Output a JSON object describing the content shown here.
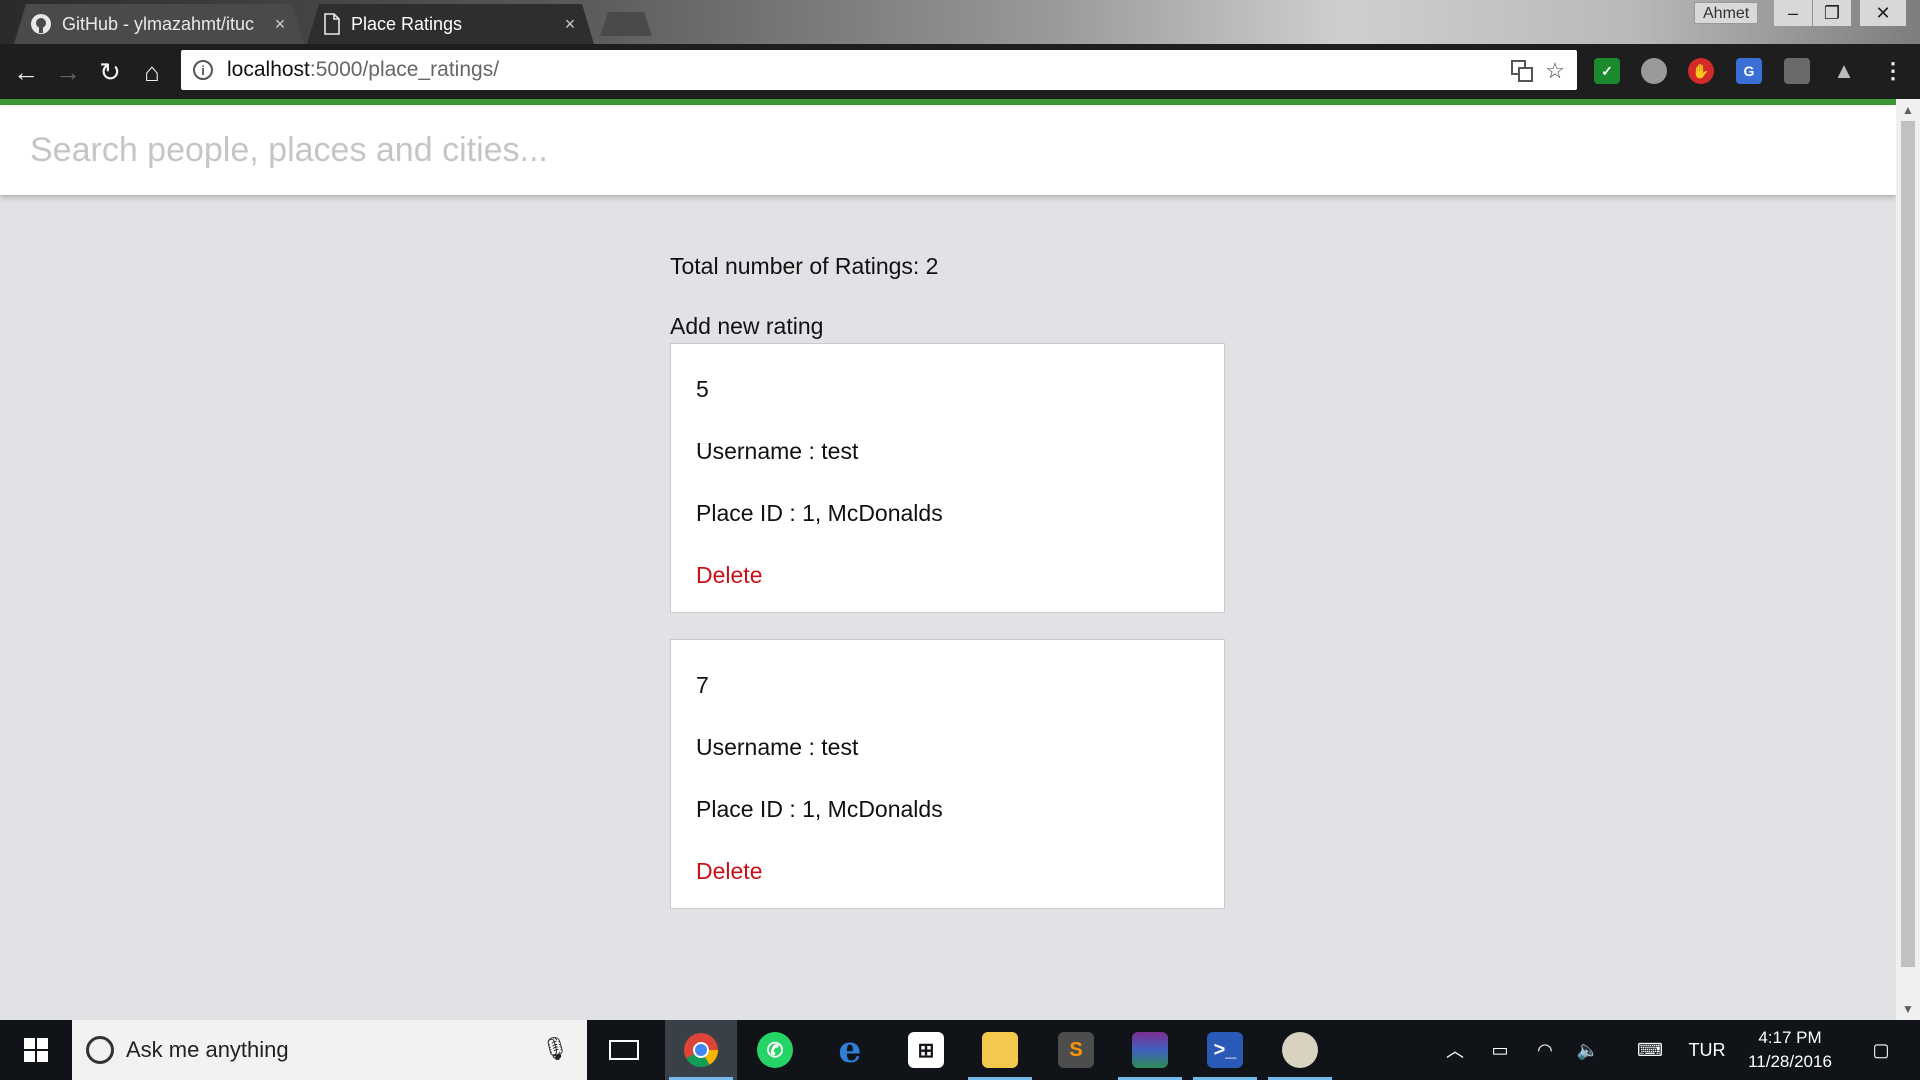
{
  "browser": {
    "tabs": [
      {
        "title": "GitHub - ylmazahmt/ituc",
        "close": "×",
        "icon": "github-icon"
      },
      {
        "title": "Place Ratings",
        "close": "×",
        "icon": "page-icon"
      }
    ],
    "window": {
      "user": "Ahmet",
      "minimize": "–",
      "restore": "❐",
      "close": "✕"
    },
    "url_host": "localhost",
    "url_path": ":5000/place_ratings/",
    "accent_color": "#3f9c35"
  },
  "page": {
    "search_placeholder": "Search people, places and cities...",
    "total_label": "Total number of Ratings: 2",
    "add_label": "Add new rating",
    "ratings": [
      {
        "score": "5",
        "username": "Username : test",
        "place": "Place ID : 1, McDonalds",
        "delete": "Delete"
      },
      {
        "score": "7",
        "username": "Username : test",
        "place": "Place ID : 1, McDonalds",
        "delete": "Delete"
      }
    ],
    "delete_color": "#c8111a"
  },
  "taskbar": {
    "search_text": "Ask me anything",
    "apps": [
      "task-view-icon",
      "chrome-icon",
      "whatsapp-icon",
      "edge-icon",
      "store-icon",
      "file-explorer-icon",
      "sublime-icon",
      "winrar-icon",
      "powershell-icon",
      "paint-icon"
    ],
    "language": "TUR",
    "time": "4:17 PM",
    "date": "11/28/2016"
  }
}
